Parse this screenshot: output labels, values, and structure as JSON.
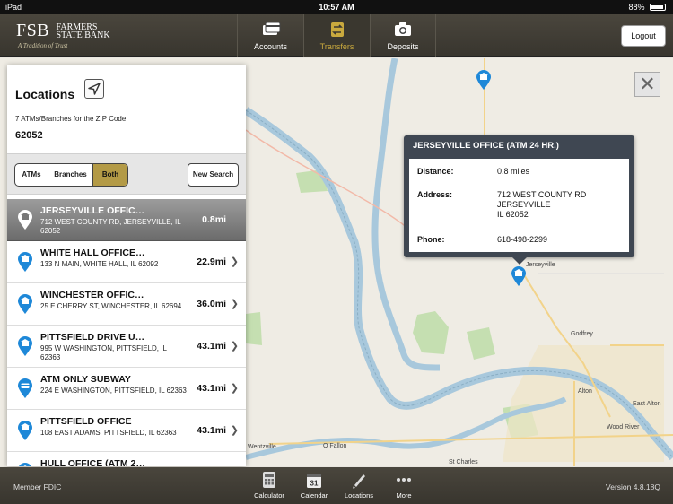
{
  "status_bar": {
    "device": "iPad",
    "time": "10:57 AM",
    "battery": "88%"
  },
  "brand": {
    "short": "FSB",
    "name_line1": "FARMERS",
    "name_line2": "STATE BANK",
    "tagline": "A Tradition of Trust"
  },
  "nav": {
    "tabs": [
      {
        "label": "Accounts",
        "icon": "cards-icon",
        "active": false
      },
      {
        "label": "Transfers",
        "icon": "transfer-arrows-icon",
        "active": true
      },
      {
        "label": "Deposits",
        "icon": "camera-icon",
        "active": false
      }
    ],
    "logout_label": "Logout"
  },
  "locations": {
    "title": "Locations",
    "summary": "7 ATMs/Branches for the ZIP Code:",
    "zip": "62052",
    "filters": [
      "ATMs",
      "Branches",
      "Both"
    ],
    "active_filter": "Both",
    "new_search_label": "New Search",
    "items": [
      {
        "name": "JERSEYVILLE OFFIC…",
        "address": "712 WEST COUNTY RD, JERSEYVILLE, IL  62052",
        "distance": "0.8mi",
        "type": "branch",
        "selected": true
      },
      {
        "name": "WHITE HALL OFFICE…",
        "address": "133 N MAIN, WHITE HALL, IL  62092",
        "distance": "22.9mi",
        "type": "branch",
        "selected": false
      },
      {
        "name": "WINCHESTER  OFFIC…",
        "address": "25 E CHERRY ST, WINCHESTER, IL  62694",
        "distance": "36.0mi",
        "type": "branch",
        "selected": false
      },
      {
        "name": "PITTSFIELD DRIVE U…",
        "address": "995 W WASHINGTON, PITTSFIELD, IL  62363",
        "distance": "43.1mi",
        "type": "branch",
        "selected": false
      },
      {
        "name": "ATM ONLY SUBWAY",
        "address": "224 E WASHINGTON, PITTSFIELD, IL  62363",
        "distance": "43.1mi",
        "type": "atm",
        "selected": false
      },
      {
        "name": "PITTSFIELD OFFICE",
        "address": "108 EAST ADAMS, PITTSFIELD, IL  62363",
        "distance": "43.1mi",
        "type": "branch",
        "selected": false
      },
      {
        "name": "HULL OFFICE (ATM 2…",
        "address": "",
        "distance": "",
        "type": "branch",
        "selected": false
      }
    ]
  },
  "popup": {
    "title": "JERSEYVILLE OFFICE (ATM 24 HR.)",
    "distance_label": "Distance:",
    "distance": "0.8 miles",
    "address_label": "Address:",
    "address_line1": "712 WEST COUNTY RD",
    "address_line2": "JERSEYVILLE",
    "address_line3": "IL  62052",
    "phone_label": "Phone:",
    "phone": "618-498-2299"
  },
  "map": {
    "labels": [
      "Jerseyville",
      "Godfrey",
      "Alton",
      "East Alton",
      "Wood River",
      "Wentzville",
      "O Fallon",
      "St Charles"
    ],
    "close_glyph": "✕"
  },
  "footer": {
    "left": "Member FDIC",
    "version": "Version 4.8.18Q",
    "tabs": [
      {
        "label": "Calculator",
        "icon": "calculator-icon"
      },
      {
        "label": "Calendar",
        "icon": "calendar-icon"
      },
      {
        "label": "Locations",
        "icon": "map-pin-icon"
      },
      {
        "label": "More",
        "icon": "more-dots-icon"
      }
    ],
    "calendar_day": "31"
  },
  "colors": {
    "accent_gold": "#b39a46",
    "pin_blue": "#1e88d8",
    "river": "#a8c8dc"
  }
}
